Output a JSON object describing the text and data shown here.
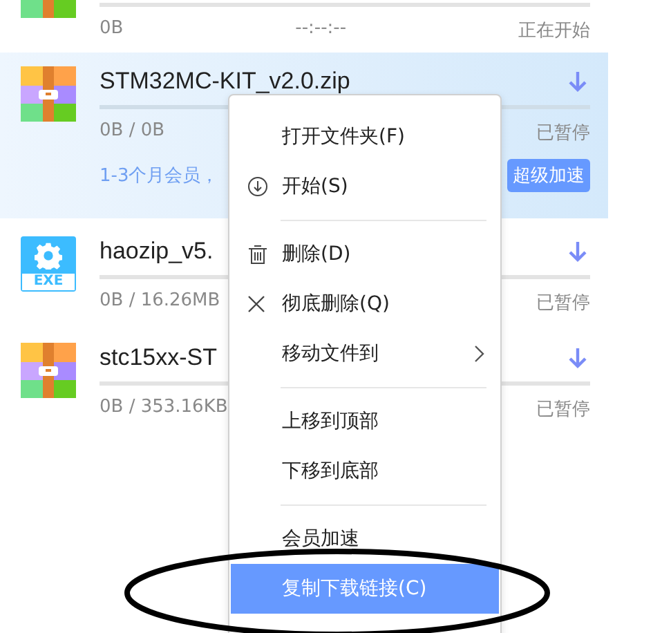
{
  "downloads": [
    {
      "kind": "zip",
      "size": "0B",
      "eta": "--:--:--",
      "status": "正在开始",
      "selected": false
    },
    {
      "kind": "zip",
      "name": "STM32MC-KIT_v2.0.zip",
      "size": "0B / 0B",
      "status": "已暂停",
      "selected": true,
      "promo": "1-3个月会员，",
      "promo_button": "超级加速"
    },
    {
      "kind": "exe",
      "badge": "EXE",
      "name": "haozip_v5.",
      "size": "0B / 16.26MB",
      "status": "已暂停",
      "selected": false
    },
    {
      "kind": "zip",
      "name": "stc15xx-ST",
      "size": "0B / 353.16KB",
      "status": "已暂停",
      "selected": false
    }
  ],
  "context_menu": [
    {
      "kind": "plain",
      "label": "打开文件夹(F)",
      "selected": false
    },
    {
      "kind": "download",
      "label": "开始(S)",
      "selected": false
    },
    {
      "kind": "divider"
    },
    {
      "kind": "trash",
      "label": "删除(D)",
      "selected": false
    },
    {
      "kind": "close",
      "label": "彻底删除(Q)",
      "selected": false
    },
    {
      "kind": "submenu",
      "label": "移动文件到",
      "selected": false
    },
    {
      "kind": "divider"
    },
    {
      "kind": "plain",
      "label": "上移到顶部",
      "selected": false
    },
    {
      "kind": "plain",
      "label": "下移到底部",
      "selected": false
    },
    {
      "kind": "divider"
    },
    {
      "kind": "plain",
      "label": "会员加速",
      "selected": false
    },
    {
      "kind": "plain",
      "label": "复制下载链接(C)",
      "selected": true
    }
  ]
}
